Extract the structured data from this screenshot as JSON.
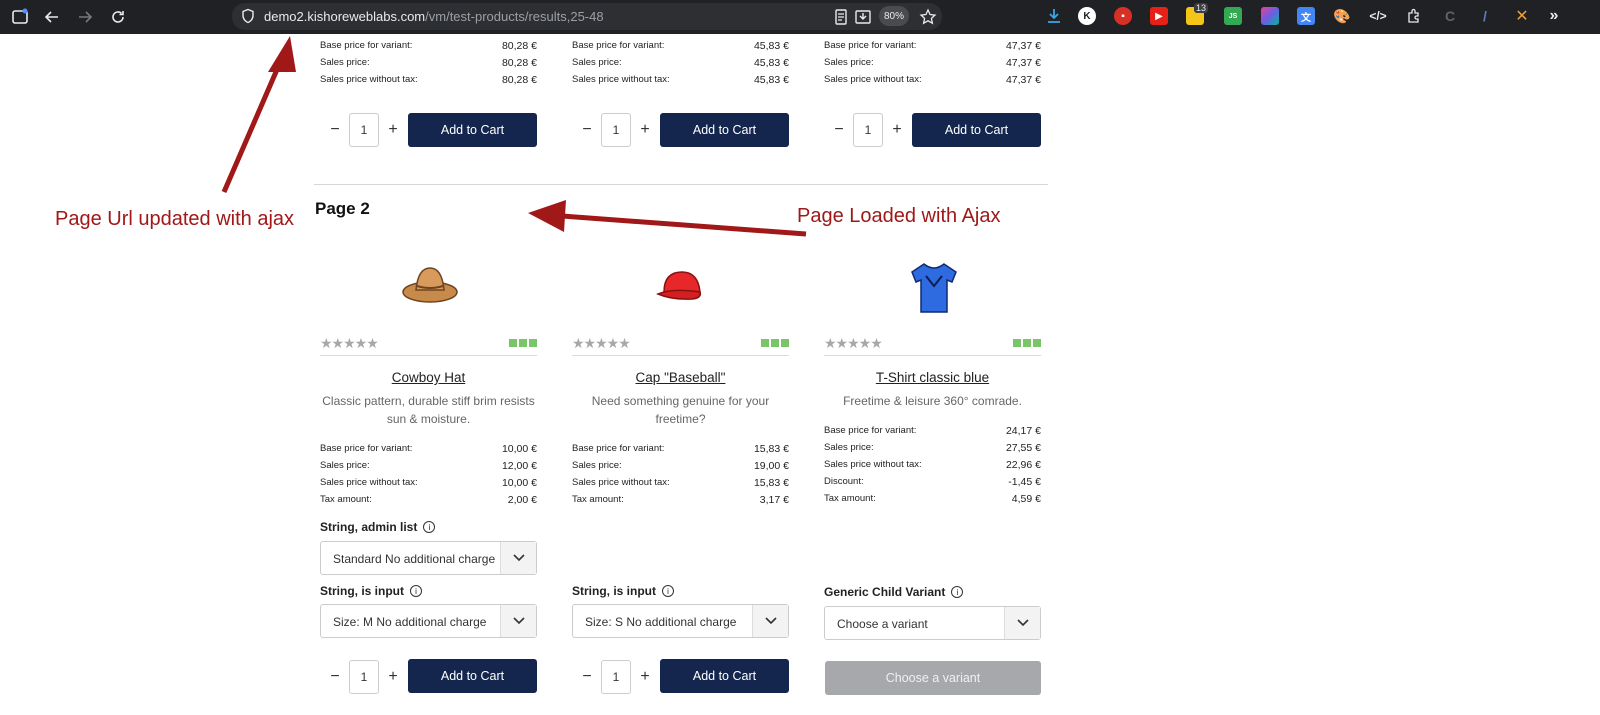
{
  "browser": {
    "url_host": "demo2.kishoreweblabs.com",
    "url_path": "/vm/test-products/results,25-48",
    "zoom": "80%",
    "ext_badge": "13"
  },
  "top_row": [
    {
      "rows": [
        {
          "label": "Base price for variant:",
          "value": "80,28 €"
        },
        {
          "label": "Sales price:",
          "value": "80,28 €"
        },
        {
          "label": "Sales price without tax:",
          "value": "80,28 €"
        }
      ],
      "qty": "1",
      "cart": "Add to Cart"
    },
    {
      "rows": [
        {
          "label": "Base price for variant:",
          "value": "45,83 €"
        },
        {
          "label": "Sales price:",
          "value": "45,83 €"
        },
        {
          "label": "Sales price without tax:",
          "value": "45,83 €"
        }
      ],
      "qty": "1",
      "cart": "Add to Cart"
    },
    {
      "rows": [
        {
          "label": "Base price for variant:",
          "value": "47,37 €"
        },
        {
          "label": "Sales price:",
          "value": "47,37 €"
        },
        {
          "label": "Sales price without tax:",
          "value": "47,37 €"
        }
      ],
      "qty": "1",
      "cart": "Add to Cart"
    }
  ],
  "annotations": {
    "url_note": "Page Url updated with ajax",
    "ajax_note": "Page Loaded with Ajax"
  },
  "page2": {
    "title": "Page 2",
    "products": [
      {
        "name": "Cowboy Hat",
        "desc": "Classic pattern, durable stiff brim resists sun & moisture.",
        "rows": [
          {
            "label": "Base price for variant:",
            "value": "10,00 €"
          },
          {
            "label": "Sales price:",
            "value": "12,00 €"
          },
          {
            "label": "Sales price without tax:",
            "value": "10,00 €"
          },
          {
            "label": "Tax amount:",
            "value": "2,00 €"
          }
        ],
        "field1_label": "String, admin list",
        "field1_value": "Standard No additional charge",
        "field2_label": "String, is input",
        "field2_value": "Size: M No additional charge",
        "qty": "1",
        "cart": "Add to Cart"
      },
      {
        "name": "Cap \"Baseball\"",
        "desc": "Need something genuine for your freetime?",
        "rows": [
          {
            "label": "Base price for variant:",
            "value": "15,83 €"
          },
          {
            "label": "Sales price:",
            "value": "19,00 €"
          },
          {
            "label": "Sales price without tax:",
            "value": "15,83 €"
          },
          {
            "label": "Tax amount:",
            "value": "3,17 €"
          }
        ],
        "field2_label": "String, is input",
        "field2_value": "Size: S No additional charge",
        "qty": "1",
        "cart": "Add to Cart"
      },
      {
        "name": "T-Shirt classic blue",
        "desc": "Freetime & leisure 360° comrade.",
        "rows": [
          {
            "label": "Base price for variant:",
            "value": "24,17 €"
          },
          {
            "label": "Sales price:",
            "value": "27,55 €"
          },
          {
            "label": "Sales price without tax:",
            "value": "22,96 €"
          },
          {
            "label": "Discount:",
            "value": "-1,45 €"
          },
          {
            "label": "Tax amount:",
            "value": "4,59 €"
          }
        ],
        "field2_label": "Generic Child Variant",
        "field2_value": "Choose a variant",
        "cart": "Choose a variant"
      }
    ]
  }
}
